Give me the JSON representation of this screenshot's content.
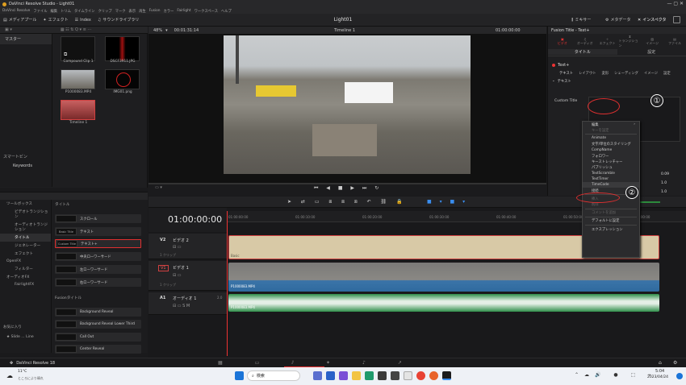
{
  "app": {
    "title": "DaVinci Resolve Studio - Light01",
    "project": "Light01"
  },
  "menu": [
    "DaVinci Resolve",
    "ファイル",
    "編集",
    "トリム",
    "タイムライン",
    "クリップ",
    "マーク",
    "表示",
    "再生",
    "Fusion",
    "カラー",
    "Fairlight",
    "ワークスペース",
    "ヘルプ"
  ],
  "toolbar": {
    "media_pool": "メディアプール",
    "effects": "エフェクト",
    "index": "Index",
    "sound_library": "サウンドライブラリ",
    "mixer": "ミキサー",
    "metadata": "メタデータ",
    "inspector": "インスペクタ"
  },
  "media": {
    "zoom": "48%",
    "source_tc": "00:01:31:14",
    "bins": [
      "マスター"
    ],
    "smart_bins": "スマートビン",
    "keywords": "Keywords",
    "clips": [
      {
        "label": "Compound Clip 1"
      },
      {
        "label": "DSCF3911.JPG"
      },
      {
        "label": "P1000083.MP4"
      },
      {
        "label": "IMG01.png"
      },
      {
        "label": "Timeline 1"
      }
    ]
  },
  "viewer": {
    "timeline_name": "Timeline 1",
    "timecode": "01:00:00:00"
  },
  "inspector": {
    "title": "Fusion Title - Text+",
    "tabs": [
      "ビデオ",
      "オーディオ",
      "エフェクト",
      "トランジション",
      "イメージ",
      "ファイル"
    ],
    "sub_tabs": [
      "タイトル",
      "設定"
    ],
    "node": "Text+",
    "text_tabs": [
      "テキスト",
      "レイアウト",
      "変形",
      "シェーディング",
      "イメージ",
      "設定"
    ],
    "section": "テキスト",
    "field_label": "Custom Title",
    "values": [
      "0.09",
      "1.0",
      "1.0"
    ]
  },
  "effects": {
    "categories": [
      "ツールボックス",
      "ビデオトランジション",
      "オーディオトランジション",
      "タイトル",
      "ジェネレーター",
      "エフェクト",
      "OpenFX",
      "フィルター",
      "オーディオFX",
      "FairlightFX"
    ],
    "favorites": "お気に入り",
    "fav_item": "Slide ... Line",
    "title_header": "タイトル",
    "fusion_header": "Fusionタイトル",
    "titles": [
      {
        "thumb": "",
        "label": "スクロール"
      },
      {
        "thumb": "Basic Title",
        "label": "テキスト"
      },
      {
        "thumb": "Custom Title",
        "label": "テキスト+"
      },
      {
        "thumb": "",
        "label": "中央ローワーサード"
      },
      {
        "thumb": "",
        "label": "左ローワーサード"
      },
      {
        "thumb": "",
        "label": "右ローワーサード"
      }
    ],
    "fusion_titles": [
      "Background Reveal",
      "Background Reveal Lower Third",
      "Call Out",
      "Center Reveal"
    ]
  },
  "timeline": {
    "timecode": "01:00:00:00",
    "ruler": [
      "01:00:00:00",
      "01:00:10:00",
      "01:00:20:00",
      "01:00:30:00",
      "01:00:40:00",
      "01:00:50:00",
      "01:01:00:00"
    ],
    "tracks": [
      {
        "id": "V2",
        "name": "ビデオ 2",
        "sub": "1 クリップ"
      },
      {
        "id": "V1",
        "name": "ビデオ 1",
        "sub": "1 クリップ"
      },
      {
        "id": "A1",
        "name": "オーディオ 1",
        "sub": "",
        "level": "2.0"
      }
    ],
    "clip_labels": {
      "v2": "Basic",
      "v1": "P1000083.MP4",
      "a1": "P1000083.MP4"
    }
  },
  "context_menu": [
    "編集",
    "キーを設定",
    "Animate",
    "文字/単位のスタイリング",
    "CompName",
    "フォロワー",
    "キーストレッチャー",
    "パブリッシュ",
    "TextScramble",
    "TextTimer",
    "TimeCode",
    "接続",
    "挿入",
    "削除",
    "コメントを追加",
    "デフォルトに設定",
    "エクスプレッション"
  ],
  "callouts": {
    "c1": "①",
    "c2": "②"
  },
  "page_nav": {
    "app": "DaVinci Resolve 18"
  },
  "taskbar": {
    "weather_temp": "11°C",
    "weather_desc": "ところにより晴れ",
    "search": "検索",
    "time": "5:04",
    "date": "2023/04/24"
  }
}
